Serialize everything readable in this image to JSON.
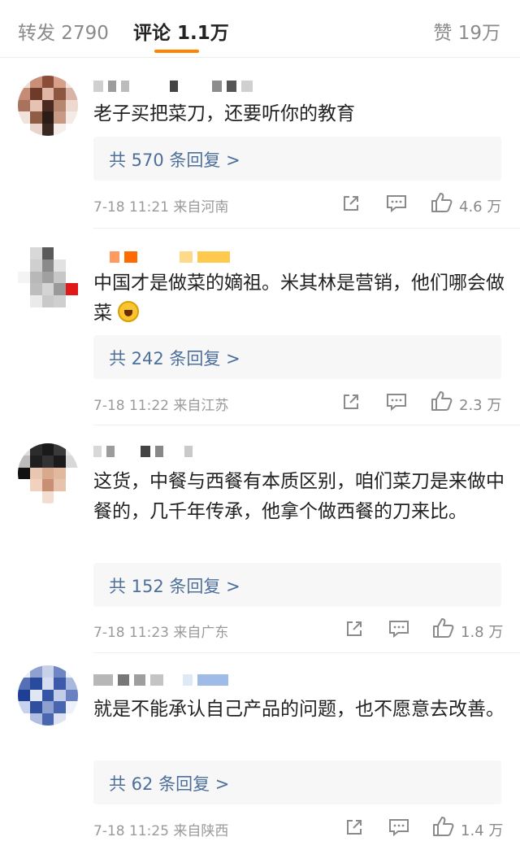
{
  "tabs": {
    "repost": "转发 2790",
    "comments": "评论 1.1万",
    "likes": "赞 19万"
  },
  "comments": [
    {
      "text": "老子买把菜刀，还要听你的教育",
      "replies": "共 570 条回复 >",
      "meta": "7-18 11:21 来自河南",
      "likes": "4.6 万"
    },
    {
      "text": "中国才是做菜的嫡祖。米其林是营销，他们哪会做菜",
      "replies": "共 242 条回复 >",
      "meta": "7-18 11:22 来自江苏",
      "likes": "2.3 万"
    },
    {
      "text": "这货，中餐与西餐有本质区别，咱们菜刀是来做中餐的，几千年传承，他拿个做西餐的刀来比。",
      "replies": "共 152 条回复 >",
      "meta": "7-18 11:23 来自广东",
      "likes": "1.8 万"
    },
    {
      "text": "就是不能承认自己产品的问题，也不愿意去改善。",
      "replies": "共 62 条回复 >",
      "meta": "7-18 11:25 来自陕西",
      "likes": "1.4 万"
    }
  ],
  "icons": {
    "share": "share-icon",
    "comment": "comment-icon",
    "like": "thumbs-up-icon",
    "emoji": "laughing-face-emoji"
  },
  "colors": {
    "accent": "#ff8200",
    "reply_link": "#4d6f9c",
    "muted": "#9a9a9a"
  }
}
